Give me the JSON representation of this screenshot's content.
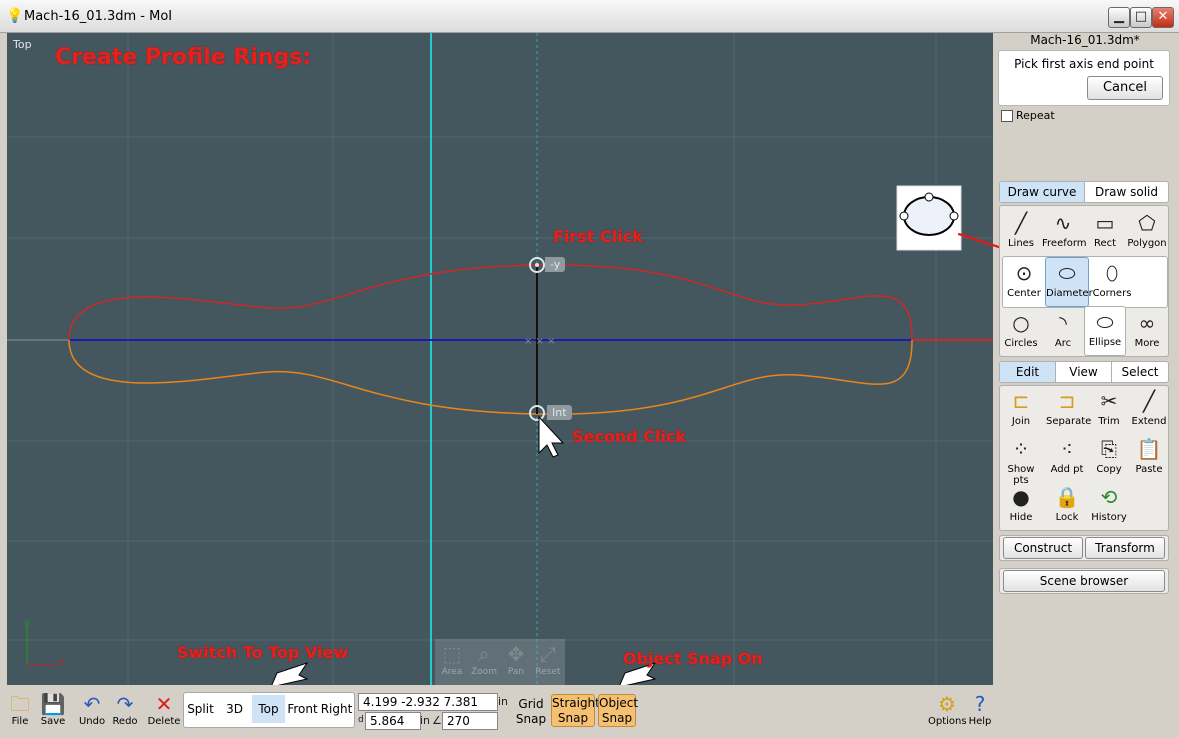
{
  "window": {
    "title": "Mach-16_01.3dm - MoI",
    "min": "▁",
    "max": "□",
    "close": "✕"
  },
  "viewport": {
    "label": "Top",
    "annotations": {
      "heading": "Create Profile Rings:",
      "first_click": "First Click",
      "second_click": "Second Click",
      "switch_view": "Switch To Top View",
      "object_snap": "Object Snap On"
    },
    "snap_tags": {
      "top": "-y",
      "bottom": "Int"
    },
    "axis": {
      "x": "x",
      "y": "y"
    },
    "nav": [
      {
        "label": "Area",
        "icon": "⬚"
      },
      {
        "label": "Zoom",
        "icon": "⌕"
      },
      {
        "label": "Pan",
        "icon": "✥"
      },
      {
        "label": "Reset",
        "icon": "⤢"
      }
    ],
    "colors": {
      "background": "#44565e",
      "upper_curve": "#d0282a",
      "lower_curve": "#e8861a",
      "axis_line": "#1b1bb0",
      "cyan_line": "#22cccc"
    }
  },
  "panel": {
    "file_name": "Mach-16_01.3dm*",
    "prompt": "Pick first axis end point",
    "cancel": "Cancel",
    "repeat": "Repeat",
    "draw_tabs": [
      "Draw curve",
      "Draw solid"
    ],
    "draw_tools_row1": [
      {
        "label": "Lines",
        "icon": "╱"
      },
      {
        "label": "Freeform",
        "icon": "∿"
      },
      {
        "label": "Rect",
        "icon": "▭"
      },
      {
        "label": "Polygon",
        "icon": "⬠"
      }
    ],
    "ellipse_tools": [
      {
        "label": "Center",
        "icon": "⊙"
      },
      {
        "label": "Diameter",
        "icon": "⬭"
      },
      {
        "label": "Corners",
        "icon": "⬯"
      }
    ],
    "draw_tools_row3": [
      {
        "label": "Circles",
        "icon": "○"
      },
      {
        "label": "Arc",
        "icon": "◝"
      },
      {
        "label": "Ellipse",
        "icon": "⬭"
      },
      {
        "label": "More",
        "icon": "∞"
      }
    ],
    "edit_tabs": [
      "Edit",
      "View",
      "Select"
    ],
    "edit_tools": [
      {
        "label": "Join",
        "icon": "⊏"
      },
      {
        "label": "Separate",
        "icon": "⊐"
      },
      {
        "label": "Trim",
        "icon": "✂"
      },
      {
        "label": "Extend",
        "icon": "╱"
      },
      {
        "label": "Show pts",
        "icon": "⁘"
      },
      {
        "label": "Add pt",
        "icon": "⁖"
      },
      {
        "label": "Copy",
        "icon": "⎘"
      },
      {
        "label": "Paste",
        "icon": "📋"
      },
      {
        "label": "Hide",
        "icon": "●"
      },
      {
        "label": "Lock",
        "icon": "🔒"
      },
      {
        "label": "History",
        "icon": "⟲"
      }
    ],
    "construct": "Construct",
    "transform": "Transform",
    "scene_browser": "Scene browser"
  },
  "toolbar": {
    "file": "File",
    "save": "Save",
    "undo": "Undo",
    "redo": "Redo",
    "delete": "Delete",
    "views": [
      "Split",
      "3D",
      "Top",
      "Front",
      "Right"
    ],
    "active_view": "Top",
    "coords": "4.199   -2.932  7.381",
    "coords_unit": "in",
    "distance_label": "d",
    "distance": "5.864",
    "distance_unit": "in",
    "angle_symbol": "∠",
    "angle": "270",
    "grid_snap": [
      "Grid",
      "Snap"
    ],
    "straight_snap": [
      "Straight",
      "Snap"
    ],
    "object_snap": [
      "Object",
      "Snap"
    ],
    "options": "Options",
    "help": "Help"
  }
}
